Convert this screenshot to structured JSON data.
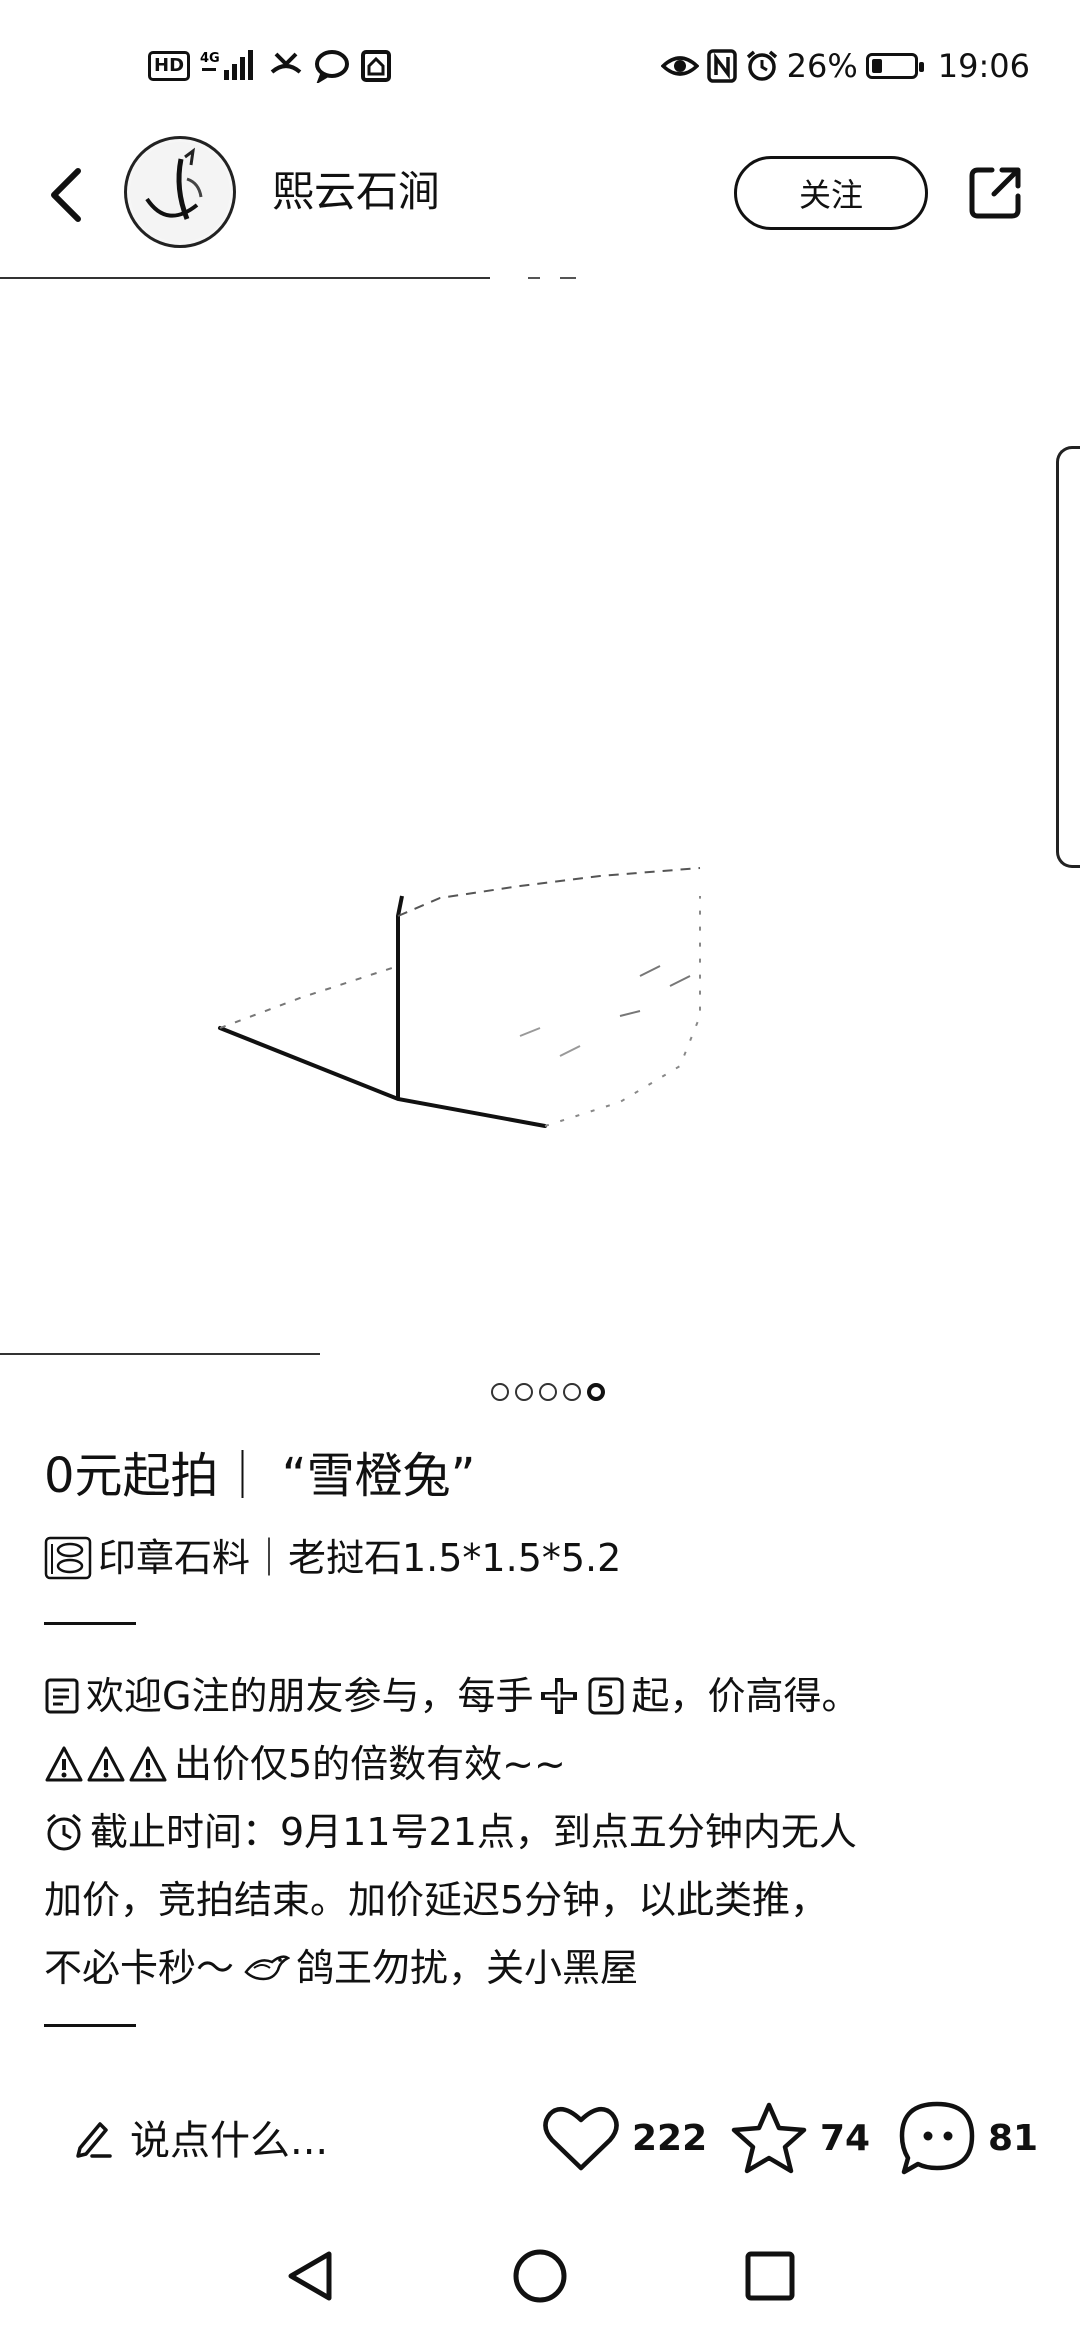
{
  "status_bar": {
    "left_icons": [
      "hd-icon",
      "signal-4g-icon",
      "missed-call-icon",
      "message-icon",
      "home-app-icon"
    ],
    "hd_label": "HD",
    "network_label": "4G",
    "battery_percent_text": "26%",
    "battery_level": 0.26,
    "time": "19:06",
    "right_icons": [
      "eye-icon",
      "nfc-icon",
      "alarm-icon",
      "battery-icon"
    ]
  },
  "header": {
    "shop_name": "熙云石涧",
    "follow_label": "关注"
  },
  "carousel": {
    "total": 5,
    "active_index": 4
  },
  "post": {
    "title": "0元起拍｜ “雪橙兔”",
    "subtitle": "印章石料｜老挝石1.5*1.5*5.2",
    "lines": [
      "欢迎G注的朋友参与，每手",
      "起，价高得。",
      "出价仅5的倍数有效~~",
      "截止时间：9月11号21点，到点五分钟内无人",
      "加价，竞拍结束。加价延迟5分钟，以此类推，",
      "不必卡秒～",
      "鸽王勿扰，关小黑屋"
    ]
  },
  "actions": {
    "comment_placeholder": "说点什么...",
    "likes": "222",
    "favorites": "74",
    "comments": "81"
  }
}
